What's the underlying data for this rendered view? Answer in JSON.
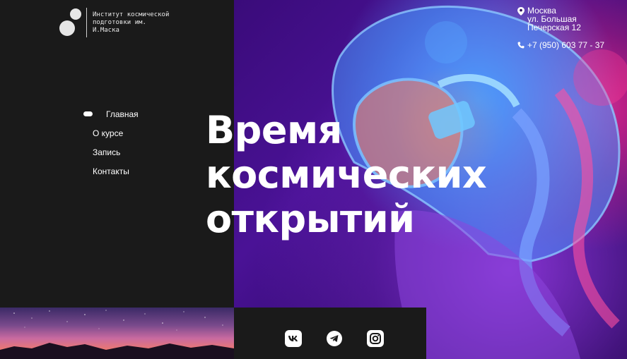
{
  "logo": {
    "text": "Институт космической\nподготовки им.\nИ.Маска"
  },
  "nav": {
    "items": [
      {
        "label": "Главная",
        "active": true
      },
      {
        "label": "О курсе",
        "active": false
      },
      {
        "label": "Запись",
        "active": false
      },
      {
        "label": "Контакты",
        "active": false
      }
    ]
  },
  "hero": {
    "headline_lines": [
      "Время",
      "космических",
      "открытий"
    ]
  },
  "contacts": {
    "address_lines": [
      "Москва",
      "ул. Большая",
      "Печерская 12"
    ],
    "phone": "+7 (950) 603 77 - 37"
  },
  "social": {
    "icons": [
      "vk-icon",
      "telegram-icon",
      "instagram-icon"
    ]
  },
  "colors": {
    "background": "#1a1a1a",
    "text": "#ffffff",
    "hero_purple": "#3a0b7a",
    "hero_blue": "#50aaff",
    "hero_pink": "#ff288c"
  }
}
